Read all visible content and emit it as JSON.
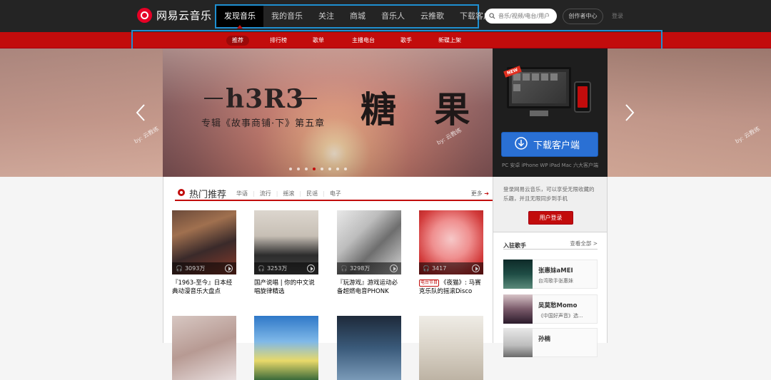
{
  "brand": {
    "name": "网易云音乐",
    "accent": "#c20c0c"
  },
  "topnav": {
    "items": [
      "发现音乐",
      "我的音乐",
      "关注",
      "商城",
      "音乐人",
      "云推歌",
      "下载客户端"
    ],
    "active": "发现音乐"
  },
  "search": {
    "placeholder": "音乐/视频/电台/用户",
    "icon": "search-icon"
  },
  "creator_button": "创作者中心",
  "login_link": "登录",
  "subnav": {
    "items": [
      "推荐",
      "排行榜",
      "歌单",
      "主播电台",
      "歌手",
      "新碟上架"
    ],
    "active": "推荐"
  },
  "banner": {
    "artist": "h3R3",
    "song": "糖 果",
    "subtitle": "专辑《故事商铺·下》第五章",
    "watermark": "by: 云教练",
    "slide_count": 8,
    "active_slide": 4
  },
  "download": {
    "badge": "NEW",
    "button": "下载客户端",
    "platforms": "PC 安卓 iPhone WP iPad Mac 六大客户端"
  },
  "hot": {
    "title": "热门推荐",
    "tags": [
      "华语",
      "流行",
      "摇滚",
      "民谣",
      "电子"
    ],
    "more": "更多",
    "cards": [
      {
        "count": "3093万",
        "title": "『1963-至今』日本经典动漫音乐大盘点"
      },
      {
        "count": "3253万",
        "title": "国产说唱 | 你的中文说唱旋律精选"
      },
      {
        "count": "3298万",
        "title": "『玩游戏』游戏运动必备超燃电音PHONK"
      },
      {
        "count": "3417",
        "badge": "电台节目",
        "title": "《夜猫》: 马赛克乐队的摇滚Disco"
      }
    ]
  },
  "login_panel": {
    "description": "登录网易云音乐，可以享受无限收藏的乐趣，并且无限同步到手机",
    "button": "用户登录"
  },
  "singers": {
    "title": "入驻歌手",
    "all": "查看全部 >",
    "list": [
      {
        "name": "张惠妹aMEI",
        "desc": "台湾歌手张惠妹"
      },
      {
        "name": "吴莫愁Momo",
        "desc": "《中国好声音》选..."
      },
      {
        "name": "孙楠",
        "desc": ""
      }
    ]
  }
}
